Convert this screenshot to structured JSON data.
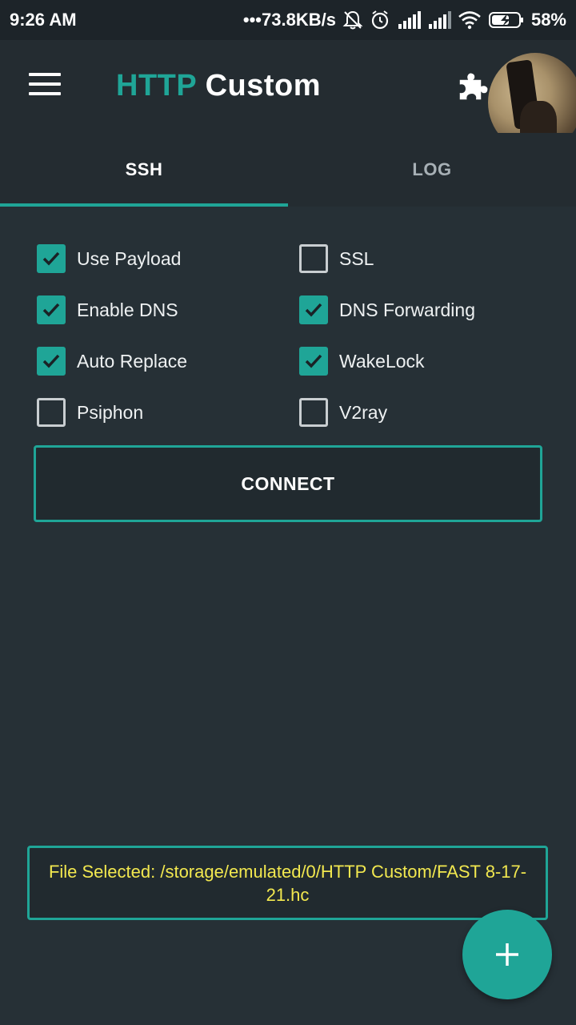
{
  "status_bar": {
    "time": "9:26 AM",
    "net_speed": "•••73.8KB/s",
    "battery": "58%",
    "icons": [
      "mute-bell-icon",
      "alarm-icon",
      "signal-icon",
      "signal-icon",
      "wifi-icon",
      "battery-charging-icon"
    ]
  },
  "toolbar": {
    "title_part1": "HTTP",
    "title_part2": "Custom",
    "menu_icon": "hamburger-menu-icon",
    "plugin_icon": "puzzle-icon"
  },
  "tabs": [
    {
      "label": "SSH",
      "active": true
    },
    {
      "label": "LOG",
      "active": false
    }
  ],
  "options": [
    {
      "label": "Use Payload",
      "checked": true
    },
    {
      "label": "SSL",
      "checked": false
    },
    {
      "label": "Enable DNS",
      "checked": true
    },
    {
      "label": "DNS Forwarding",
      "checked": true
    },
    {
      "label": "Auto Replace",
      "checked": true
    },
    {
      "label": "WakeLock",
      "checked": true
    },
    {
      "label": "Psiphon",
      "checked": false
    },
    {
      "label": "V2ray",
      "checked": false
    }
  ],
  "connect_label": "CONNECT",
  "file_selected": "File Selected: /storage/emulated/0/HTTP Custom/FAST 8-17-21.hc",
  "colors": {
    "accent": "#1fa597",
    "background": "#263036",
    "file_text": "#f2e84f"
  }
}
